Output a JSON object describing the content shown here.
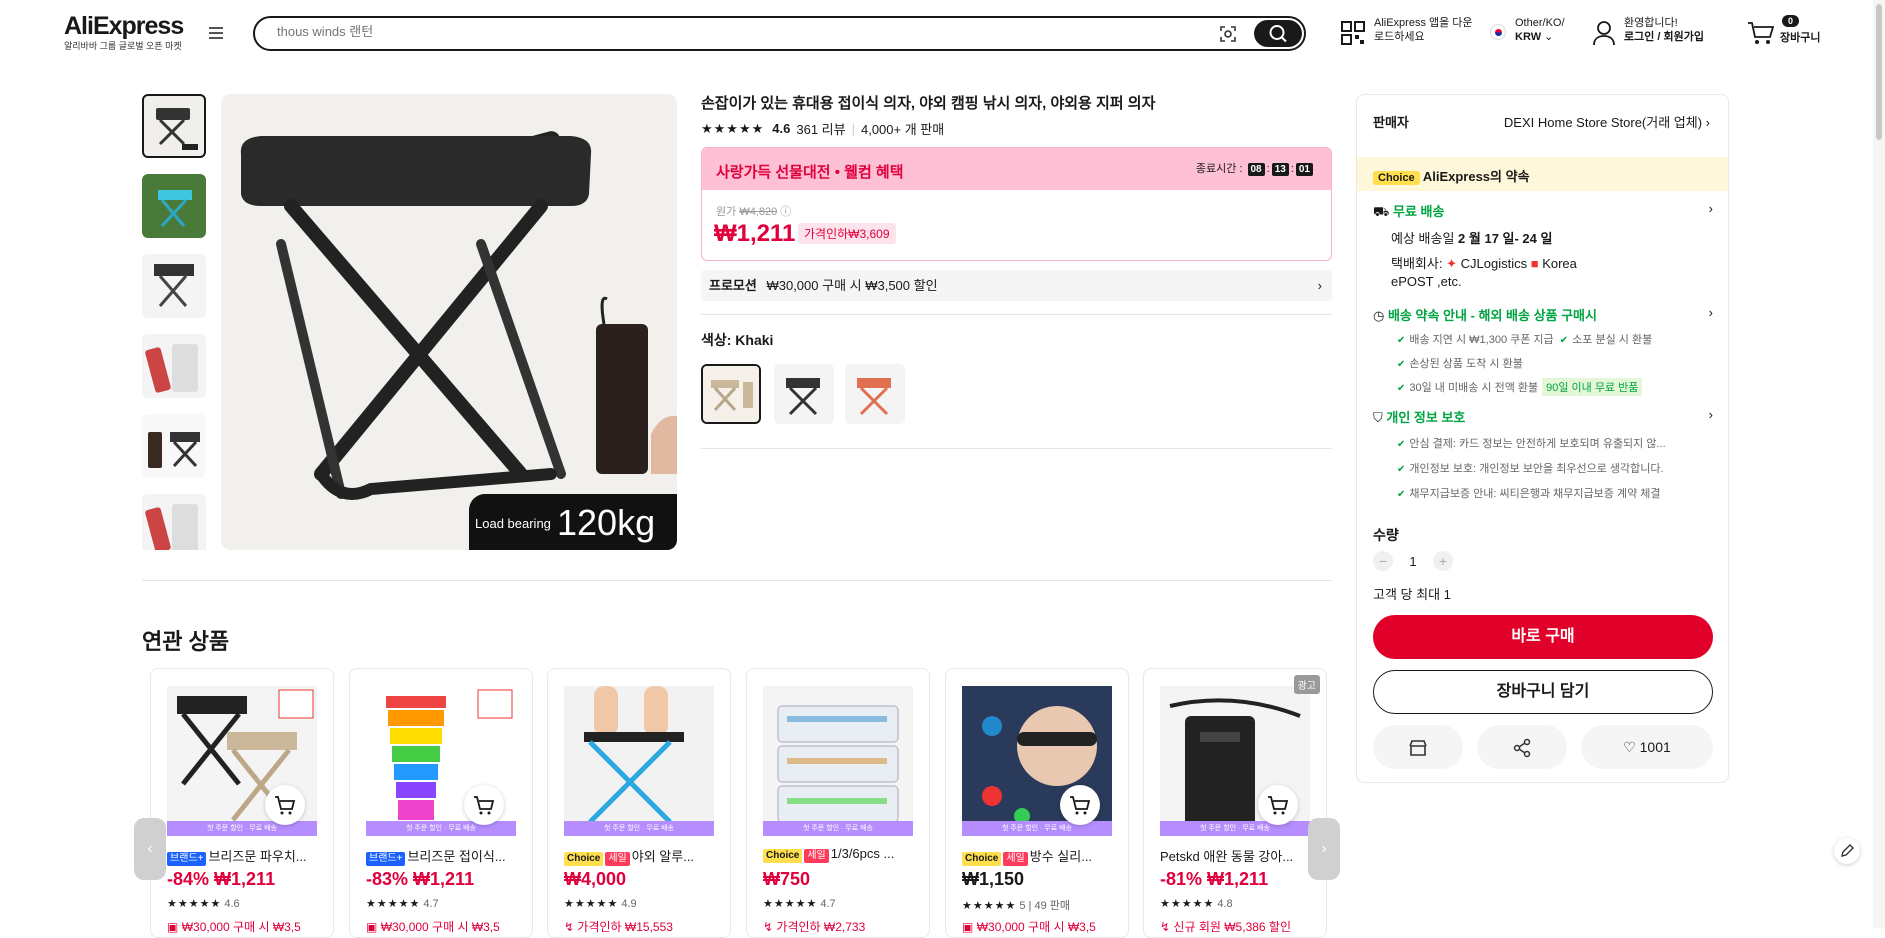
{
  "header": {
    "logo": "AliExpress",
    "logo_tagline": "알리바바 그룹 글로벌 오픈 마켓",
    "search_placeholder": "thous winds 랜턴",
    "app_download": "AliExpress 앱을 다운로드하세요",
    "region_top": "Other/KO/",
    "region_currency": "KRW",
    "welcome": "환영합니다!",
    "login": "로그인 / 회원가입",
    "cart_count": "0",
    "cart_label": "장바구니"
  },
  "product": {
    "title": "손잡이가 있는 휴대용 접이식 의자, 야외 캠핑 낚시 의자, 야외용 지퍼 의자",
    "rating": "4.6",
    "reviews": "361 리뷰",
    "sold": "4,000+ 개 판매",
    "image_overlay_label": "Load bearing",
    "image_overlay_value": "120kg",
    "event_title_red": "사랑가득 선물대전",
    "event_title_rest": " • 웰컴 혜택",
    "timer_label": "종료시간 :",
    "timer_h": "08",
    "timer_m": "13",
    "timer_s": "01",
    "original_label": "원가",
    "original_price": "₩4,820",
    "price": "₩1,211",
    "discount": "가격인하₩3,609",
    "promotion_label": "프로모션",
    "promotion_text": "₩30,000 구매 시 ₩3,500 할인",
    "color_label": "색상: Khaki"
  },
  "seller": {
    "label": "판매자",
    "name": "DEXI Home Store Store(거래 업체)",
    "choice_badge": "Choice",
    "choice_promise": "AliExpress의 약속",
    "free_shipping": "무료 배송",
    "delivery_prefix": "예상 배송일",
    "delivery_dates": "2 월 17 일- 24 일",
    "carrier_label": "택배회사:",
    "carrier1": "CJLogistics",
    "carrier2": "Korea",
    "carrier_more": "ePOST ,etc.",
    "guarantee_title": "배송 약속 안내 - 해외 배송 상품 구매시",
    "g1": "배송 지연 시 ₩1,300 쿠폰 지급",
    "g2": "소포 분실 시 환불",
    "g3": "손상된 상품 도착 시 환불",
    "g4": "30일 내 미배송 시 전액 환불",
    "g4_badge": "90일 이내 무료 반품",
    "privacy_title": "개인 정보 보호",
    "p1": "안심 결제: 카드 정보는 안전하게 보호되며 유출되지 않...",
    "p2": "개인정보 보호: 개인정보 보안을 최우선으로 생각합니다.",
    "p3": "채무지급보증 안내: 씨티은행과 채무지급보증 계약 체결",
    "qty_label": "수량",
    "qty_minus": "−",
    "qty_value": "1",
    "qty_plus": "+",
    "max_qty": "고객 당 최대 1",
    "buy_now": "바로 구매",
    "add_cart": "장바구니 담기",
    "wish_count": "1001"
  },
  "related": {
    "title": "연관 상품",
    "strip_text": "첫 주문 할인 · 무료 배송",
    "ad_badge": "광고",
    "prev": "‹",
    "next": "›",
    "items": [
      {
        "tag1": "브랜드+",
        "tag2": "",
        "name": "브리즈문 파우치...",
        "discount": "-84%",
        "price": "₩1,211",
        "rating": "4.6",
        "sold": "",
        "coupon": "₩30,000 구매 시 ₩3,5"
      },
      {
        "tag1": "브랜드+",
        "tag2": "",
        "name": "브리즈문 접이식...",
        "discount": "-83%",
        "price": "₩1,211",
        "rating": "4.7",
        "sold": "",
        "coupon": "₩30,000 구매 시 ₩3,5"
      },
      {
        "tag1": "Choice",
        "tag2": "세일",
        "name": "야외 알루...",
        "discount": "",
        "price": "₩4,000",
        "rating": "4.9",
        "sold": "",
        "coupon": "가격인하 ₩15,553"
      },
      {
        "tag1": "Choice",
        "tag2": "세일",
        "name": "1/3/6pcs ...",
        "discount": "",
        "price": "₩750",
        "rating": "4.7",
        "sold": "",
        "coupon": "가격인하 ₩2,733"
      },
      {
        "tag1": "Choice",
        "tag2": "세일",
        "name": "방수 실리...",
        "discount": "",
        "price": "₩1,150",
        "rating": "5",
        "sold": "49 판매",
        "coupon": "₩30,000 구매 시 ₩3,5"
      },
      {
        "tag1": "",
        "tag2": "",
        "name": "Petskd 애완 동물 강아...",
        "discount": "-81%",
        "price": "₩1,211",
        "rating": "4.8",
        "sold": "",
        "coupon": "신규 회원 ₩5,386 할인"
      }
    ]
  }
}
